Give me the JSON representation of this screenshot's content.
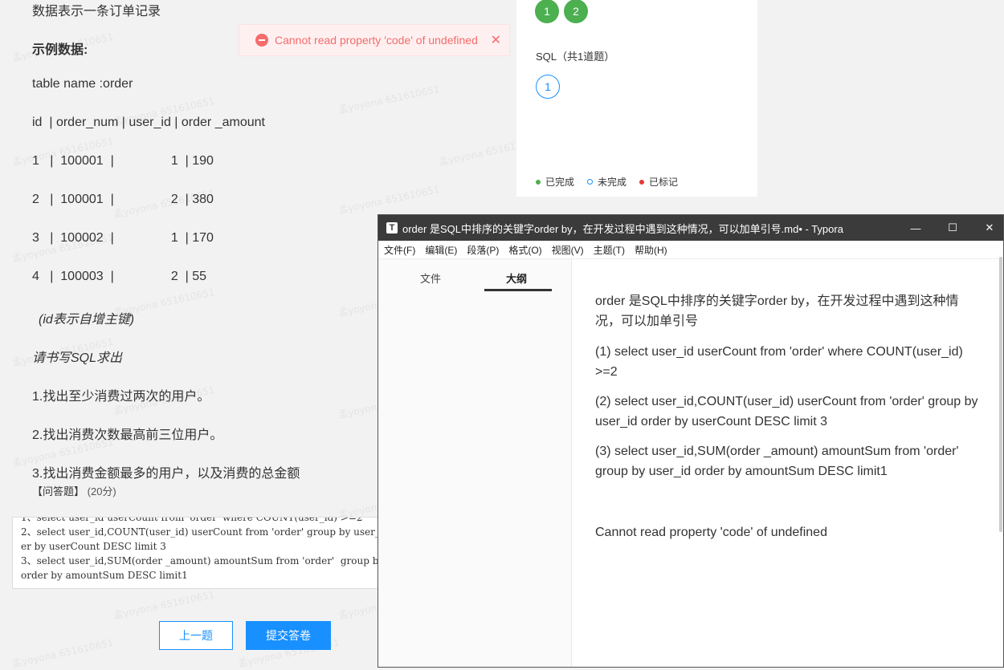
{
  "question": {
    "lines": {
      "intro": "数据表示一条订单记录",
      "sample_heading": "示例数据:",
      "table_name": "table name :order",
      "header": "id  | order_num | user_id | order _amount",
      "row1": "1   |  100001  |                1  | 190",
      "row2": "2   |  100001  |                2  | 380",
      "row3": "3   |  100002  |                1  | 170",
      "row4": "4   |  100003  |                2  | 55",
      "note": "(id表示自增主键)",
      "prompt": "请书写SQL求出",
      "task1": "1.找出至少消费过两次的用户。",
      "task2": "2.找出消费次数最高前三位用户。",
      "task3": "3.找出消费金额最多的用户，以及消费的总金额"
    },
    "type_label": "【问答题】",
    "score": "(20分)",
    "answer": "1、select user_id userCount from 'order' where COUNT(user_id) >=2\n2、select user_id,COUNT(user_id) userCount from 'order' group by user_id ord\ner by userCount DESC limit 3\n3、select user_id,SUM(order _amount) amountSum from 'order'  group by user_id\norder by amountSum DESC limit1",
    "prev_button": "上一题",
    "submit_button": "提交答卷"
  },
  "toast": {
    "message": "Cannot read property 'code' of undefined",
    "close": "✕"
  },
  "card": {
    "done_numbers": [
      "1",
      "2"
    ],
    "section_title": "SQL（共1道题）",
    "sql_numbers": [
      "1"
    ],
    "legend": {
      "done": "已完成",
      "todo": "未完成",
      "marked": "已标记"
    },
    "colors": {
      "done": "#4caf50",
      "todo": "#1890ff",
      "marked": "#e53935"
    }
  },
  "typora": {
    "title": "order 是SQL中排序的关键字order by，在开发过程中遇到这种情况，可以加单引号.md• - Typora",
    "app_letter": "T",
    "controls": {
      "minimize": "—",
      "maximize": "☐",
      "close": "✕"
    },
    "menu": [
      "文件(F)",
      "编辑(E)",
      "段落(P)",
      "格式(O)",
      "视图(V)",
      "主题(T)",
      "帮助(H)"
    ],
    "sidebar_tabs": {
      "files": "文件",
      "outline": "大纲"
    },
    "content": {
      "p1": "order 是SQL中排序的关键字order by，在开发过程中遇到这种情况，可以加单引号",
      "p2": "(1) select user_id userCount from 'order' where COUNT(user_id) >=2",
      "p3": "(2) select user_id,COUNT(user_id) userCount from 'order' group by user_id  order by userCount DESC limit 3",
      "p4": "(3) select user_id,SUM(order _amount) amountSum from 'order' group by user_id order by amountSum DESC limit1",
      "p5": "Cannot read property 'code' of undefined"
    }
  }
}
